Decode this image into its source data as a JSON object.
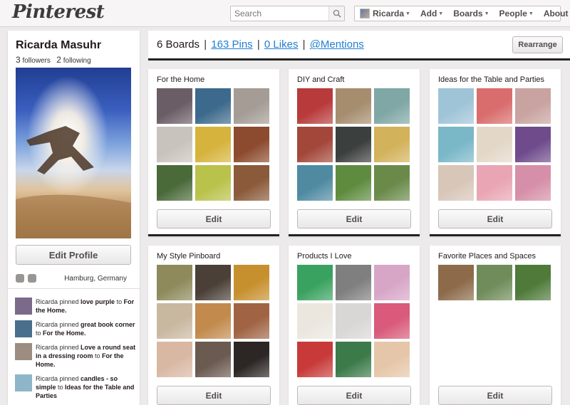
{
  "header": {
    "logo": "Pinterest",
    "search_placeholder": "Search",
    "nav": [
      "Ricarda",
      "Add",
      "Boards",
      "People",
      "About"
    ]
  },
  "profile": {
    "name": "Ricarda Masuhr",
    "followers_count": "3",
    "followers_label": "followers",
    "following_count": "2",
    "following_label": "following",
    "edit_profile_label": "Edit Profile",
    "location": "Hamburg, Germany"
  },
  "activity": [
    {
      "prefix": "Ricarda pinned ",
      "pin": "love purple",
      "mid": " to ",
      "board": "For the Home."
    },
    {
      "prefix": "Ricarda pinned ",
      "pin": "great book corner",
      "mid": " to ",
      "board": "For the Home."
    },
    {
      "prefix": "Ricarda pinned ",
      "pin": "Love a round seat in a dressing room",
      "mid": " to ",
      "board": "For the Home."
    },
    {
      "prefix": "Ricarda pinned ",
      "pin": "candles - so simple",
      "mid": " to ",
      "board": "Ideas for the Table and Parties"
    }
  ],
  "stats": {
    "boards": "6 Boards",
    "pins": "163 Pins",
    "likes": "0 Likes",
    "mentions": "@Mentions",
    "separator": "|",
    "rearrange_label": "Rearrange"
  },
  "boards": [
    {
      "title": "For the Home",
      "edit_label": "Edit",
      "colors": [
        "#6b5d66",
        "#3d6a8c",
        "#a49c95",
        "#c9c3bd",
        "#d6b33c",
        "#8c4a2e",
        "#4a6a3a",
        "#b9c24a",
        "#8a5a3a"
      ]
    },
    {
      "title": "DIY and Craft",
      "edit_label": "Edit",
      "colors": [
        "#b83a3a",
        "#a58d6e",
        "#7fa7a5",
        "#a3473a",
        "#3b3f3d",
        "#d2b25a",
        "#4f8aa1",
        "#5e8b3e",
        "#6a8a4a"
      ]
    },
    {
      "title": "Ideas for the Table and Parties",
      "edit_label": "Edit",
      "colors": [
        "#9fc4d8",
        "#d96c6c",
        "#c8a3a0",
        "#7ab7c7",
        "#e3d8c8",
        "#6f4b8c",
        "#d8c6b8",
        "#e9a5b4",
        "#d68fa8"
      ]
    },
    {
      "title": "My Style Pinboard",
      "edit_label": "Edit",
      "colors": [
        "#8e8a5c",
        "#4a4038",
        "#c7902f",
        "#c9b8a0",
        "#c28a4c",
        "#a06444",
        "#d9b8a3",
        "#6a5a50",
        "#2c2624"
      ]
    },
    {
      "title": "Products I Love",
      "edit_label": "Edit",
      "colors": [
        "#3aa260",
        "#7f7f7f",
        "#d7a6c7",
        "#ebe7df",
        "#d9d6d6",
        "#d95a7a",
        "#c83a3a",
        "#3c7a4a",
        "#e6c6a8"
      ]
    },
    {
      "title": "Favorite Places and Spaces",
      "edit_label": "Edit",
      "colors": [
        "#8c6a4a",
        "#6f8c5a",
        "#4f7a3a"
      ]
    }
  ]
}
